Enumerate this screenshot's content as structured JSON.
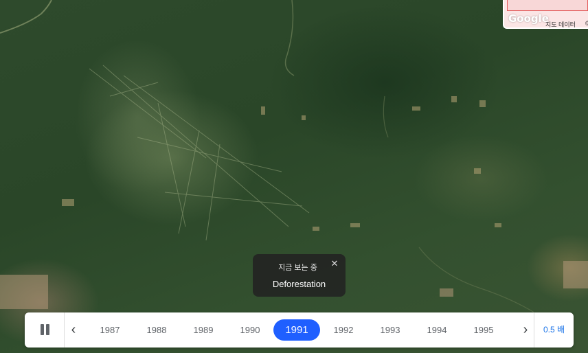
{
  "map": {
    "type": "satellite-timelapse",
    "minimap": {
      "logo": "Google",
      "credit": "지도 데이터",
      "credit_tail": "©"
    }
  },
  "now_viewing": {
    "label": "지금 보는 중",
    "title": "Deforestation",
    "close_icon": "close-icon"
  },
  "timeline": {
    "play_state_icon": "pause-icon",
    "prev_icon": "chevron-left-icon",
    "next_icon": "chevron-right-icon",
    "years": [
      "1987",
      "1988",
      "1989",
      "1990",
      "1991",
      "1992",
      "1993",
      "1994",
      "1995"
    ],
    "selected_year": "1991",
    "speed": "0.5 배"
  },
  "colors": {
    "accent": "#1f5fff",
    "speed_text": "#1a73e8",
    "tooltip_bg": "#222222",
    "forest": "#2e4a2c"
  }
}
